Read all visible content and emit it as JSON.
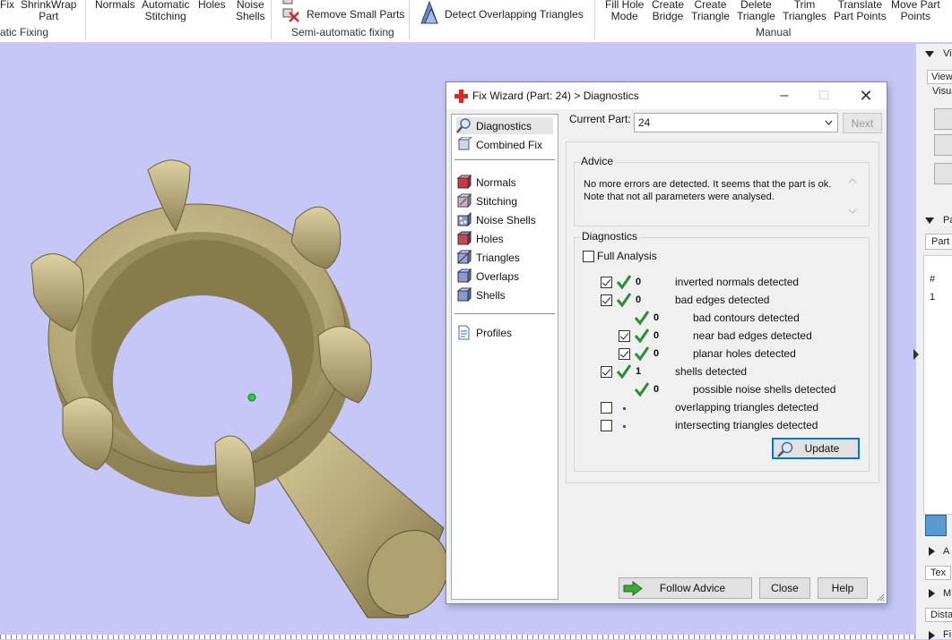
{
  "ribbon": {
    "buttons": [
      {
        "label": "Fix"
      },
      {
        "label": "ShrinkWrap\nPart"
      },
      {
        "label": "Normals"
      },
      {
        "label": "Automatic\nStitching"
      },
      {
        "label": "Holes"
      },
      {
        "label": "Noise\nShells"
      },
      {
        "label": "Fill Hole\nMode"
      },
      {
        "label": "Create\nBridge"
      },
      {
        "label": "Create\nTriangle"
      },
      {
        "label": "Delete\nTriangle"
      },
      {
        "label": "Trim\nTriangles"
      },
      {
        "label": "Translate\nPart Points"
      },
      {
        "label": "Move Part\nPoints"
      }
    ],
    "remove_small_parts": "Remove Small Parts",
    "detect_overlapping": "Detect Overlapping Triangles",
    "groups": {
      "auto": "atic Fixing",
      "semi": "Semi-automatic fixing",
      "manual": "Manual"
    }
  },
  "right_panel": {
    "items": [
      "Vi",
      "View",
      "Visua",
      "Pa",
      "Part",
      "#",
      "1",
      "A",
      "Tex",
      "M",
      "Dista",
      "Fi"
    ]
  },
  "dialog": {
    "title": "Fix Wizard (Part: 24) > Diagnostics",
    "nav": {
      "diagnostics": "Diagnostics",
      "combined_fix": "Combined Fix",
      "normals": "Normals",
      "stitching": "Stitching",
      "noise_shells": "Noise Shells",
      "holes": "Holes",
      "triangles": "Triangles",
      "overlaps": "Overlaps",
      "shells": "Shells",
      "profiles": "Profiles"
    },
    "current_part_label": "Current Part:",
    "current_part_value": "24",
    "next_label": "Next",
    "advice_title": "Advice",
    "advice_text_1": "No more errors are detected. It seems that the part is ok.",
    "advice_text_2": "Note that not all parameters were analysed.",
    "diagnostics_title": "Diagnostics",
    "full_analysis": "Full Analysis",
    "rows": [
      {
        "count": "0",
        "label": "inverted normals detected"
      },
      {
        "count": "0",
        "label": "bad edges detected"
      },
      {
        "count": "0",
        "label": "bad contours detected"
      },
      {
        "count": "0",
        "label": "near bad edges detected"
      },
      {
        "count": "0",
        "label": "planar holes detected"
      },
      {
        "count": "1",
        "label": "shells detected"
      },
      {
        "count": "0",
        "label": "possible noise shells detected"
      },
      {
        "count": "",
        "label": "overlapping triangles detected"
      },
      {
        "count": "",
        "label": "intersecting triangles detected"
      }
    ],
    "update_label": "Update",
    "follow_advice_label": "Follow Advice",
    "close_label": "Close",
    "help_label": "Help"
  },
  "colors": {
    "viewport_bg": "#c6c7f6",
    "model_gold": "#b7a978",
    "check_green": "#2e8b3a",
    "button_focus": "#0078d7"
  }
}
